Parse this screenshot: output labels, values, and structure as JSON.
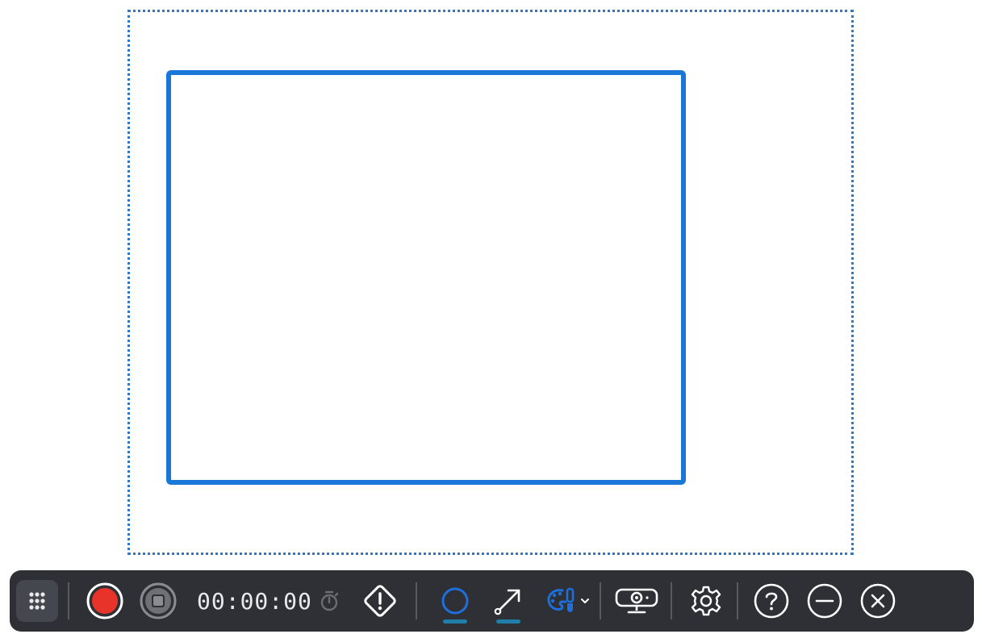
{
  "toolbar": {
    "timer_text": "00:00:00",
    "icons": [
      "drag-handle-icon",
      "record-icon",
      "stop-icon",
      "timer-icon",
      "warning-icon",
      "circle-shape-icon",
      "arrow-tool-icon",
      "palette-brush-icon",
      "chevron-down-icon",
      "webcam-icon",
      "gear-icon",
      "help-icon",
      "minimize-icon",
      "close-icon"
    ]
  },
  "colors": {
    "capture_border": "#2f78c4",
    "drawn_shape": "#1877d8",
    "toolbar_bg": "#2e3035",
    "record_red": "#e8332b",
    "accent_blue": "#1e6fd9",
    "active_underline": "#1f7fa8"
  }
}
